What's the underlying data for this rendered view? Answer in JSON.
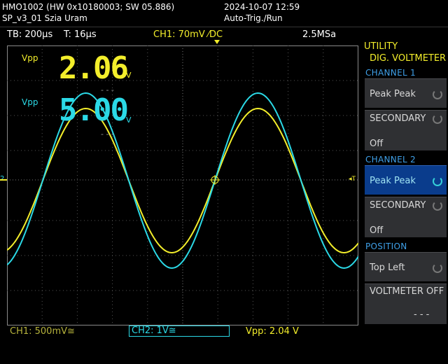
{
  "header": {
    "device": "HMO1002 (HW 0x10180003; SW 05.886)",
    "file": "SP_v3_01 Szia Uram",
    "datetime": "2024-10-07 12:59",
    "trigger_mode": "Auto-Trig./Run"
  },
  "status": {
    "timebase": "TB: 200µs",
    "time": "T: 16µs",
    "ch1": "CH1: 70mV ⁄DC",
    "sample_rate": "2.5MSa"
  },
  "voltmeter_display": {
    "ch1_label": "Vpp",
    "ch1_value": "2.06",
    "ch1_unit": "V",
    "ch1_dashes": "- - -",
    "ch2_label": "Vpp",
    "ch2_value": "5.00",
    "ch2_unit": "V",
    "ch2_dashes": "- - -"
  },
  "markers": {
    "left_ch": "2",
    "right_trig": "◂T"
  },
  "bottom": {
    "ch1": "CH1: 500mV≅",
    "ch2": "CH2: 1V≅",
    "vpp": "Vpp: 2.04 V"
  },
  "softkeys": {
    "menu_title": "UTILITY",
    "menu_subtitle": "DIG. VOLTMETER",
    "section_ch1": "CHANNEL 1",
    "ch1_measure": "Peak Peak",
    "ch1_secondary_label": "SECONDARY",
    "ch1_secondary_value": "Off",
    "section_ch2": "CHANNEL 2",
    "ch2_measure": "Peak Peak",
    "ch2_secondary_label": "SECONDARY",
    "ch2_secondary_value": "Off",
    "section_position": "POSITION",
    "position_value": "Top Left",
    "voltmeter_off": "VOLTMETER OFF",
    "voltmeter_off_sub": "- - -"
  },
  "colors": {
    "ch1": "#f3ee2b",
    "ch2": "#2bd9e6",
    "accent": "#3fa0e8"
  }
}
